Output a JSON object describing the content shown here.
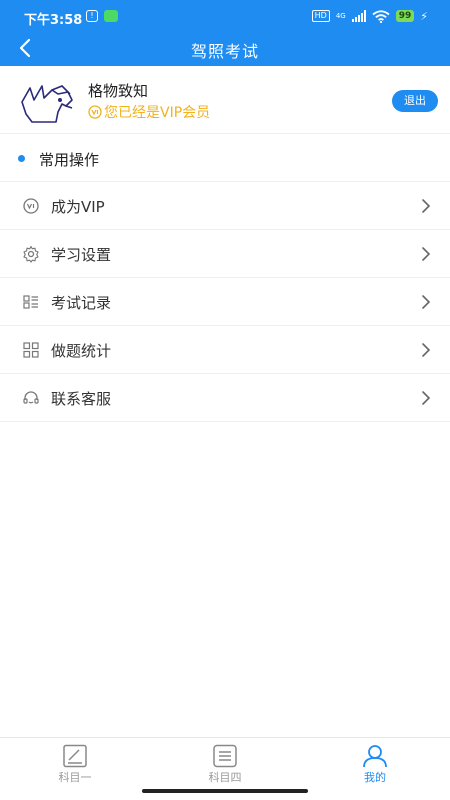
{
  "status_bar": {
    "time": "下午3:58",
    "hd": "HD",
    "network": "4G",
    "battery": "99"
  },
  "header": {
    "title": "驾照考试"
  },
  "profile": {
    "name": "格物致知",
    "vip_text": "您已经是VIP会员",
    "logout_label": "退出"
  },
  "section": {
    "title": "常用操作"
  },
  "menu": [
    {
      "label": "成为VIP",
      "icon": "vip-icon"
    },
    {
      "label": "学习设置",
      "icon": "gear-icon"
    },
    {
      "label": "考试记录",
      "icon": "list-icon"
    },
    {
      "label": "做题统计",
      "icon": "grid-icon"
    },
    {
      "label": "联系客服",
      "icon": "headset-icon"
    }
  ],
  "tabs": [
    {
      "label": "科目一",
      "icon": "edit-note-icon",
      "active": false
    },
    {
      "label": "科目四",
      "icon": "document-icon",
      "active": false
    },
    {
      "label": "我的",
      "icon": "user-icon",
      "active": true
    }
  ],
  "colors": {
    "primary": "#1e8cf0",
    "vip": "#f1b21d"
  }
}
